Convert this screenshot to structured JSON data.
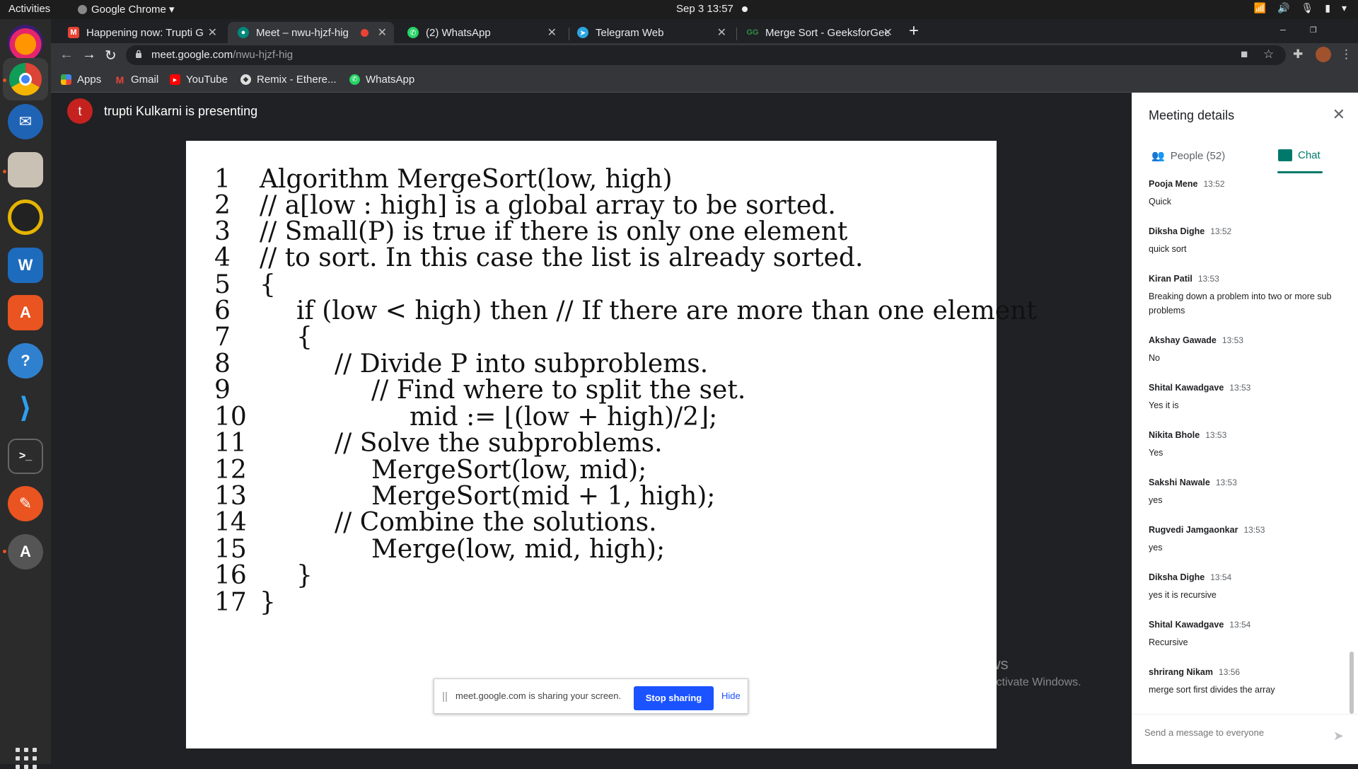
{
  "topbar": {
    "activities": "Activities",
    "app_name": "Google Chrome ▾",
    "clock": "Sep 3  13:57"
  },
  "tabs": [
    {
      "title": "Happening now: Trupti G",
      "favicon": "gmail-icon",
      "color": "#ea4335"
    },
    {
      "title": "Meet – nwu-hjzf-hig",
      "favicon": "meet-icon",
      "color": "#00897b"
    },
    {
      "title": "(2) WhatsApp",
      "favicon": "whatsapp-icon",
      "color": "#25d366"
    },
    {
      "title": "Telegram Web",
      "favicon": "telegram-icon",
      "color": "#2ca5e0"
    },
    {
      "title": "Merge Sort - GeeksforGee",
      "favicon": "gfg-icon",
      "color": "#2f8d46"
    }
  ],
  "address": {
    "domain": "meet.google.com",
    "path": "/nwu-hjzf-hig"
  },
  "bookmarks": [
    {
      "label": "Apps",
      "icon": "apps-icon"
    },
    {
      "label": "Gmail",
      "icon": "gmail-icon"
    },
    {
      "label": "YouTube",
      "icon": "youtube-icon"
    },
    {
      "label": "Remix - Ethere...",
      "icon": "remix-icon"
    },
    {
      "label": "WhatsApp",
      "icon": "whatsapp-icon"
    }
  ],
  "meet": {
    "presenter_initial": "t",
    "presenter_text": "trupti Kulkarni is presenting",
    "code": [
      {
        "n": "1",
        "text": "Algorithm MergeSort(low, high)"
      },
      {
        "n": "2",
        "text": "// a[low : high] is a global array to be sorted."
      },
      {
        "n": "3",
        "text": "// Small(P) is true if there is only one element"
      },
      {
        "n": "4",
        "text": "// to sort. In this case the list is already sorted."
      },
      {
        "n": "5",
        "text": "{"
      },
      {
        "n": "6",
        "text": "if (low < high) then  // If there are more than one element"
      },
      {
        "n": "7",
        "text": "{"
      },
      {
        "n": "8",
        "text": "// Divide P into subproblems."
      },
      {
        "n": "9",
        "text": "// Find where to split the set."
      },
      {
        "n": "10",
        "text": "mid := ⌊(low + high)/2⌋;"
      },
      {
        "n": "11",
        "text": "// Solve the subproblems."
      },
      {
        "n": "12",
        "text": "MergeSort(low, mid);"
      },
      {
        "n": "13",
        "text": "MergeSort(mid + 1, high);"
      },
      {
        "n": "14",
        "text": "// Combine the solutions."
      },
      {
        "n": "15",
        "text": "Merge(low, mid, high);"
      },
      {
        "n": "16",
        "text": "}"
      },
      {
        "n": "17",
        "text": "}"
      }
    ],
    "share_msg": "meet.google.com is sharing your screen.",
    "stop_sharing": "Stop sharing",
    "hide": "Hide",
    "watermark_title": "Activate Windows",
    "watermark_sub": "Go to PC settings to activate Windows."
  },
  "panel": {
    "title": "Meeting details",
    "people_tab": "People (52)",
    "chat_tab": "Chat",
    "messages": [
      {
        "who": "Pooja Mene",
        "time": "13:52",
        "text": "Quick"
      },
      {
        "who": "Diksha Dighe",
        "time": "13:52",
        "text": "quick sort"
      },
      {
        "who": "Kiran Patil",
        "time": "13:53",
        "text": "Breaking down a problem into two or more sub problems"
      },
      {
        "who": "Akshay Gawade",
        "time": "13:53",
        "text": "No"
      },
      {
        "who": "Shital Kawadgave",
        "time": "13:53",
        "text": "Yes it is"
      },
      {
        "who": "Nikita Bhole",
        "time": "13:53",
        "text": "Yes"
      },
      {
        "who": "Sakshi Nawale",
        "time": "13:53",
        "text": "yes"
      },
      {
        "who": "Rugvedi Jamgaonkar",
        "time": "13:53",
        "text": "yes"
      },
      {
        "who": "Diksha Dighe",
        "time": "13:54",
        "text": "yes it is recursive"
      },
      {
        "who": "Shital Kawadgave",
        "time": "13:54",
        "text": "Recursive"
      },
      {
        "who": "shrirang Nikam",
        "time": "13:56",
        "text": "merge sort first divides the array"
      }
    ],
    "input_placeholder": "Send a message to everyone"
  }
}
